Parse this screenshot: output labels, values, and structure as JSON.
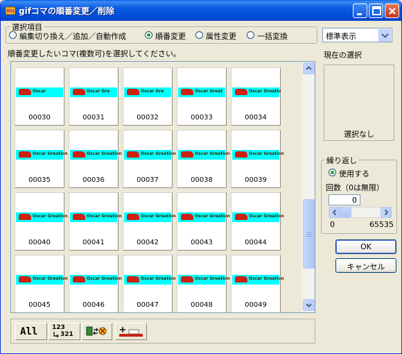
{
  "window": {
    "title": "gifコマの順番変更／削除"
  },
  "selection_group": {
    "legend": "選択項目",
    "options": [
      {
        "label": "編集切り換え／追加／自動作成",
        "selected": false
      },
      {
        "label": "順番変更",
        "selected": true
      },
      {
        "label": "属性変更",
        "selected": false
      },
      {
        "label": "一括変換",
        "selected": false
      }
    ]
  },
  "display_select": {
    "value": "標準表示"
  },
  "instruction": "順番変更したいコマ(複数可)を選択してください。",
  "frames": [
    {
      "number": "00030",
      "banner": "Oscar"
    },
    {
      "number": "00031",
      "banner": "Oscar Gre"
    },
    {
      "number": "00032",
      "banner": "Oscar Gre"
    },
    {
      "number": "00033",
      "banner": "Oscar Great"
    },
    {
      "number": "00034",
      "banner": "Oscar Greatio"
    },
    {
      "number": "00035",
      "banner": "Oscar Greation"
    },
    {
      "number": "00036",
      "banner": "Oscar Greation"
    },
    {
      "number": "00037",
      "banner": "Oscar Greation"
    },
    {
      "number": "00038",
      "banner": "Oscar Greation"
    },
    {
      "number": "00039",
      "banner": "Oscar Greation"
    },
    {
      "number": "00040",
      "banner": "Oscar Greation"
    },
    {
      "number": "00041",
      "banner": "Oscar Greation"
    },
    {
      "number": "00042",
      "banner": "Oscar Greation"
    },
    {
      "number": "00043",
      "banner": "Oscar Greation"
    },
    {
      "number": "00044",
      "banner": "Oscar Greation"
    },
    {
      "number": "00045",
      "banner": "Oscar Greation"
    },
    {
      "number": "00046",
      "banner": "Oscar Greation"
    },
    {
      "number": "00047",
      "banner": "Oscar Greation"
    },
    {
      "number": "00048",
      "banner": "Oscar Greation"
    },
    {
      "number": "00049",
      "banner": "Oscar Greation"
    }
  ],
  "toolbar": {
    "all_label": "All",
    "order_top": "123",
    "order_bottom": "321"
  },
  "current_selection": {
    "label": "現在の選択",
    "value": "選択なし"
  },
  "loop": {
    "legend": "繰り返し",
    "use_label": "使用する",
    "use_selected": true,
    "count_label": "回数（0は無限）",
    "count_value": "0",
    "slider_min": "0",
    "slider_max": "65535"
  },
  "buttons": {
    "ok": "OK",
    "cancel": "キャンセル"
  },
  "colors": {
    "banner": "#00ffff",
    "car": "#d02010",
    "title_bar": "#0054e3"
  }
}
